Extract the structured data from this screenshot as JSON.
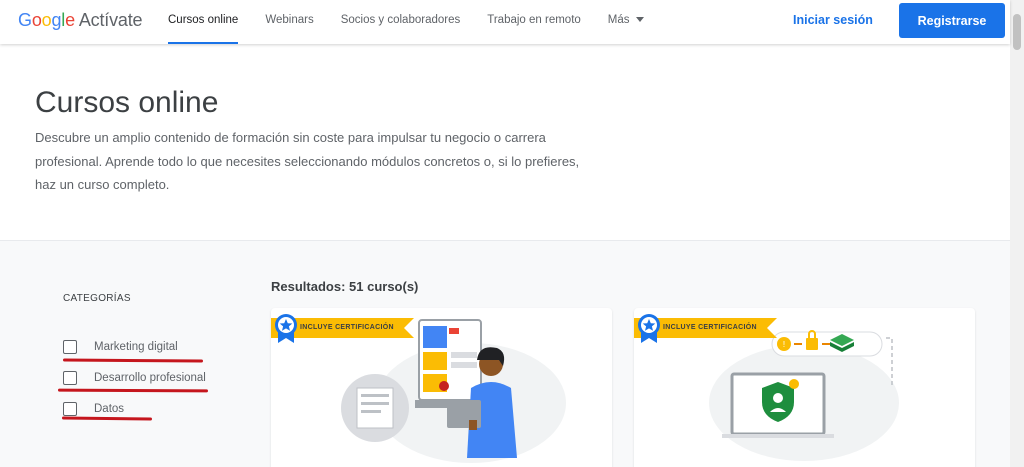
{
  "header": {
    "logo": {
      "google": [
        "G",
        "o",
        "o",
        "g",
        "l",
        "e"
      ],
      "product": "Actívate"
    },
    "nav": [
      {
        "label": "Cursos online",
        "active": true
      },
      {
        "label": "Webinars",
        "active": false
      },
      {
        "label": "Socios y colaboradores",
        "active": false
      },
      {
        "label": "Trabajo en remoto",
        "active": false
      },
      {
        "label": "Más",
        "active": false,
        "dropdown": true
      }
    ],
    "login_label": "Iniciar sesión",
    "register_label": "Registrarse"
  },
  "hero": {
    "title": "Cursos online",
    "description": "Descubre un amplio contenido de formación sin coste para impulsar tu negocio o carrera profesional. Aprende todo lo que necesites seleccionando módulos concretos o, si lo prefieres, haz un curso completo."
  },
  "filters": {
    "title": "CATEGORÍAS",
    "items": [
      {
        "label": "Marketing digital",
        "checked": false
      },
      {
        "label": "Desarrollo profesional",
        "checked": false
      },
      {
        "label": "Datos",
        "checked": false
      }
    ]
  },
  "results": {
    "label": "Resultados: 51 curso(s)",
    "cards": [
      {
        "ribbon": "INCLUYE CERTIFICACIÓN",
        "icon": "person-with-laptop-illustration"
      },
      {
        "ribbon": "INCLUYE CERTIFICACIÓN",
        "icon": "security-shield-illustration"
      }
    ]
  },
  "colors": {
    "accent": "#1a73e8",
    "ribbon": "#fbbc04",
    "annotation_underline": "#c5161d",
    "section_bg": "#f8f9fa"
  }
}
